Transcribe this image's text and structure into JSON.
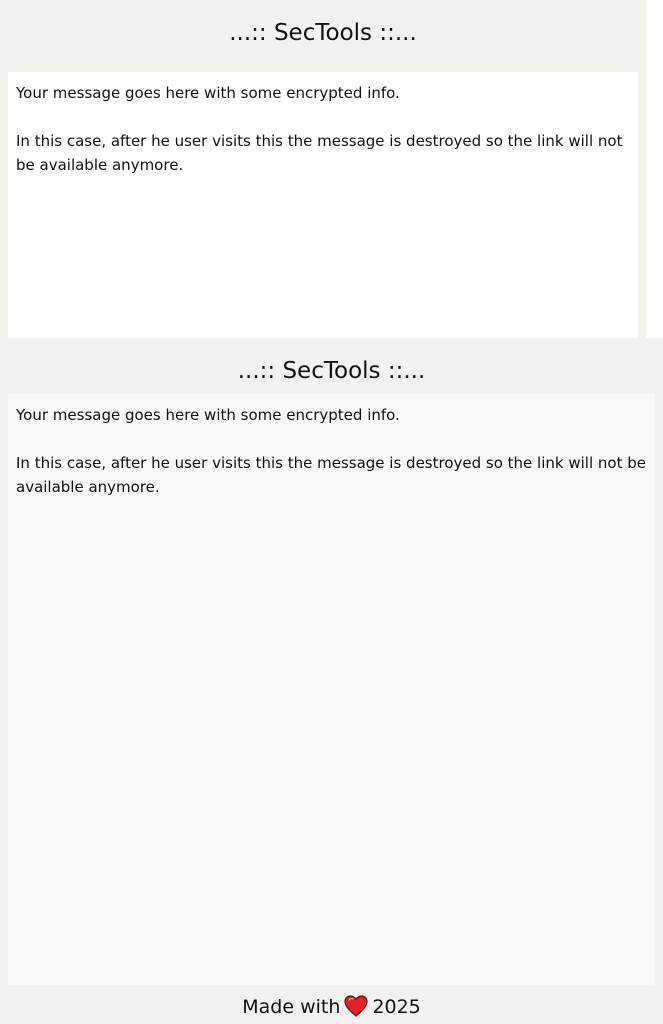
{
  "header": {
    "title": "...:: SecTools ::..."
  },
  "message": {
    "line1": "Your message goes here with some encrypted info.",
    "line2": "In this case, after he user visits this the message is destroyed so the link will not be available anymore."
  },
  "preview": {
    "title": "...:: SecTools ::...",
    "line1": "Your message goes here with some encrypted info.",
    "line2": "In this case, after he user visits this the message is destroyed so the link will not be available anymore."
  },
  "footer": {
    "prefix": "Made with",
    "icon": "heart-icon",
    "year": "2025"
  },
  "colors": {
    "background": "#f2f3ee",
    "top_panel": "#ffffff",
    "bottom_panel": "#f9f9f5",
    "heart": "#e0202a"
  }
}
